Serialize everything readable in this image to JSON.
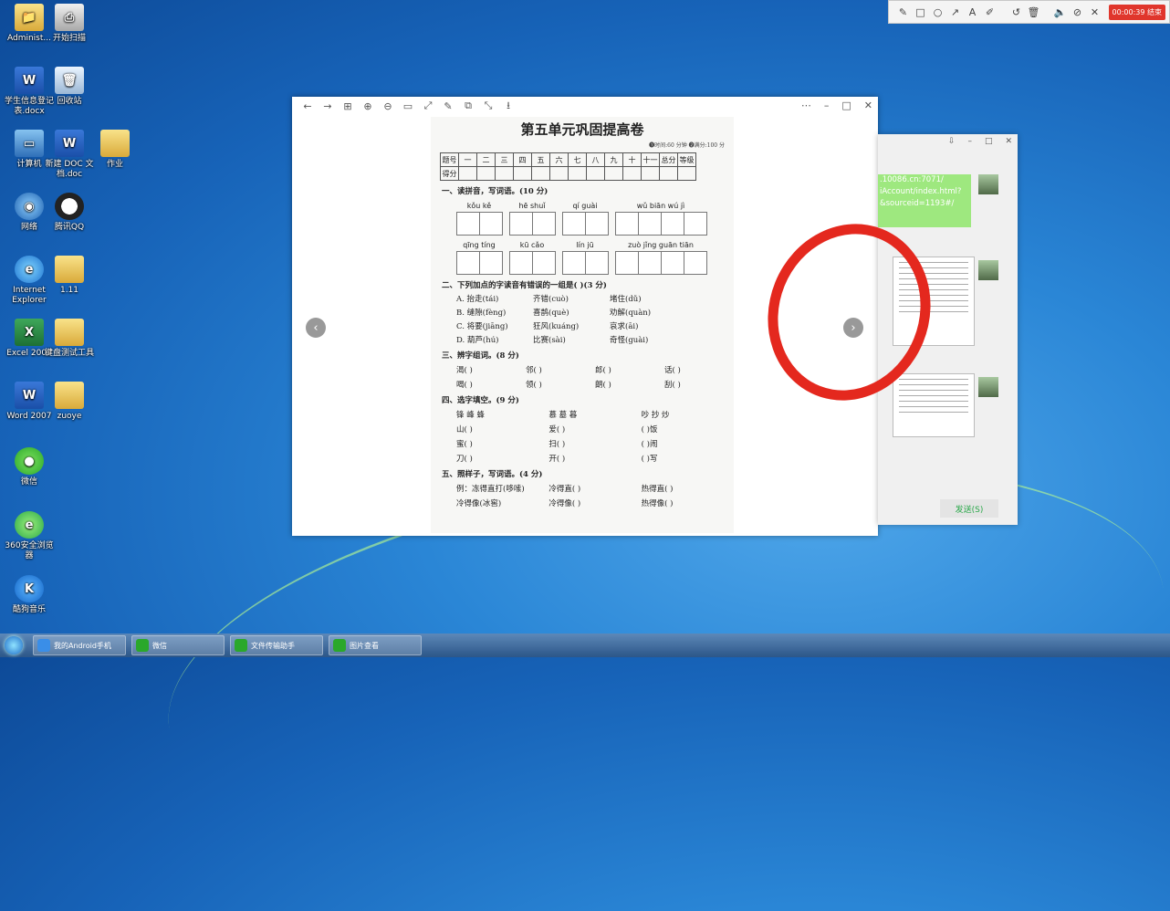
{
  "desktop": {
    "icons": [
      {
        "label": "Administ...",
        "glyph": "📁",
        "kind": "folder"
      },
      {
        "label": "开始扫描",
        "glyph": "⎙",
        "kind": "scan"
      },
      {
        "label": "学生信息登记表.docx",
        "glyph": "W",
        "kind": "word"
      },
      {
        "label": "回收站",
        "glyph": "🗑",
        "kind": "bin"
      },
      {
        "label": "计算机",
        "glyph": "▭",
        "kind": "pc"
      },
      {
        "label": "新建 DOC 文档.doc",
        "glyph": "W",
        "kind": "word"
      },
      {
        "label": "作业",
        "glyph": "",
        "kind": "folder"
      },
      {
        "label": "网络",
        "glyph": "◉",
        "kind": "net"
      },
      {
        "label": "腾讯QQ",
        "glyph": "",
        "kind": "qq"
      },
      {
        "label": "Internet Explorer",
        "glyph": "e",
        "kind": "ie"
      },
      {
        "label": "1.11",
        "glyph": "",
        "kind": "folder"
      },
      {
        "label": "Excel 2007",
        "glyph": "X",
        "kind": "excel"
      },
      {
        "label": "键盘测试工具",
        "glyph": "",
        "kind": "folder"
      },
      {
        "label": "Word 2007",
        "glyph": "W",
        "kind": "word"
      },
      {
        "label": "zuoye",
        "glyph": "",
        "kind": "folder"
      },
      {
        "label": "微信",
        "glyph": "●",
        "kind": "wechat"
      },
      {
        "label": "360安全浏览器",
        "glyph": "e",
        "kind": "360"
      },
      {
        "label": "酷狗音乐",
        "glyph": "K",
        "kind": "kugou"
      }
    ]
  },
  "recorder": {
    "tools": [
      "pen-icon",
      "rectangle-icon",
      "circle-icon",
      "arrow-icon",
      "text-icon",
      "highlighter-icon",
      "undo-icon",
      "trash-icon",
      "volume-icon",
      "camera-off-icon",
      "close-icon"
    ],
    "tool_glyphs": [
      "✎",
      "□",
      "○",
      "↗",
      "A",
      "✐",
      "↺",
      "🗑",
      "🔈",
      "⊘",
      "✕"
    ],
    "timer_label": "00:00:39 结束"
  },
  "viewer": {
    "toolbar_glyphs": [
      "←",
      "→",
      "⊞",
      "⊕",
      "⊖",
      "▭",
      "⤢",
      "✎",
      "⧉",
      "⤡",
      "⭳"
    ],
    "window_glyphs": [
      "⋯",
      "–",
      "□",
      "✕"
    ],
    "prev_glyph": "‹",
    "next_glyph": "›",
    "doc": {
      "title": "第五单元巩固提高卷",
      "subtitle": "❶时间:60 分钟   ❷满分:100 分",
      "score_header": [
        "题号",
        "一",
        "二",
        "三",
        "四",
        "五",
        "六",
        "七",
        "八",
        "九",
        "十",
        "十一",
        "总分",
        "等级"
      ],
      "score_row_label": "得分",
      "sec1": "一、读拼音，写词语。(10 分)",
      "pinyin_row1": [
        "kǒu  kě",
        "hē  shuǐ",
        "qí  guài",
        "wǔ  biān  wú  jì"
      ],
      "pinyin_row2": [
        "qīng  tíng",
        "kū  cǎo",
        "lín  jū",
        "zuò  jǐng  guān  tiān"
      ],
      "sec2": "二、下列加点的字读音有错误的一组是(    )(3 分)",
      "sec2_options": [
        [
          "A. 抬走(tái)",
          "齐错(cuò)",
          "堵住(dǔ)"
        ],
        [
          "B. 缝隙(fèng)",
          "喜鹊(què)",
          "劝解(quàn)"
        ],
        [
          "C. 将要(jiāng)",
          "狂风(kuáng)",
          "哀求(āi)"
        ],
        [
          "D. 葫芦(hú)",
          "比赛(sài)",
          "奇怪(guài)"
        ]
      ],
      "sec3": "三、辨字组词。(8 分)",
      "sec3_lines": [
        [
          "渴(    )",
          "邻(    )",
          "郎(    )",
          "话(    )"
        ],
        [
          "喝(    )",
          "领(    )",
          "朗(    )",
          "刮(    )"
        ]
      ],
      "sec4": "四、选字填空。(9 分)",
      "sec4_choices": [
        "锋  峰  蜂",
        "慕  墓  暮",
        "吵  抄  炒"
      ],
      "sec4_lines": [
        [
          "山(    )",
          "爱(    )",
          "(    )饭"
        ],
        [
          "蜜(    )",
          "扫(    )",
          "(    )闹"
        ],
        [
          "刀(    )",
          "开(    )",
          "(    )写"
        ]
      ],
      "sec5": "五、照样子，写词语。(4 分)",
      "sec5_lines": [
        [
          "例：冻得直打(哆嗦)",
          "冷得直(        )",
          "热得直(        )"
        ],
        [
          "冷得像(冰窖)",
          "冷得像(        )",
          "热得像(        )"
        ]
      ]
    }
  },
  "chat": {
    "window_glyphs": [
      "⇩",
      "–",
      "□",
      "✕"
    ],
    "bubble_lines": [
      ".10086.cn:7071/",
      "iAccount/index.html?",
      "&sourceid=1193#/"
    ],
    "send_label": "发送(S)"
  },
  "taskbar": {
    "tasks": [
      {
        "label": "我的Android手机",
        "color": "#3a8ee8"
      },
      {
        "label": "微信",
        "color": "#2aa82a"
      },
      {
        "label": "文件传输助手",
        "color": "#2aa82a"
      },
      {
        "label": "图片查看",
        "color": "#2aa82a"
      }
    ]
  }
}
